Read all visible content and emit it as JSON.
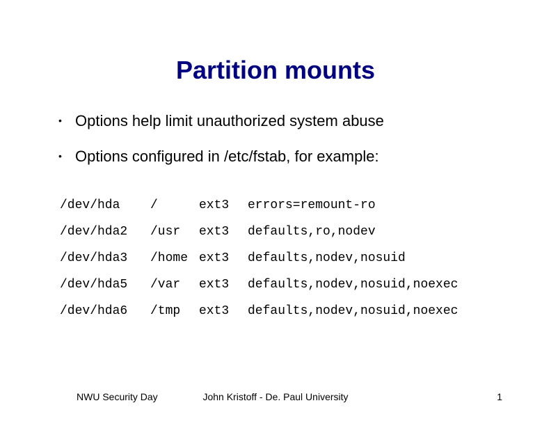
{
  "title": "Partition mounts",
  "bullets": [
    "Options help limit unauthorized system abuse",
    "Options configured in /etc/fstab, for example:"
  ],
  "fstab": [
    {
      "device": "/dev/hda",
      "mount": "/",
      "fs": "ext3",
      "opts": "errors=remount-ro"
    },
    {
      "device": "/dev/hda2",
      "mount": "/usr",
      "fs": "ext3",
      "opts": "defaults,ro,nodev"
    },
    {
      "device": "/dev/hda3",
      "mount": "/home",
      "fs": "ext3",
      "opts": "defaults,nodev,nosuid"
    },
    {
      "device": "/dev/hda5",
      "mount": "/var",
      "fs": "ext3",
      "opts": "defaults,nodev,nosuid,noexec"
    },
    {
      "device": "/dev/hda6",
      "mount": "/tmp",
      "fs": "ext3",
      "opts": "defaults,nodev,nosuid,noexec"
    }
  ],
  "footer": {
    "left": "NWU Security Day",
    "center": "John Kristoff - De. Paul University",
    "right": "1"
  }
}
